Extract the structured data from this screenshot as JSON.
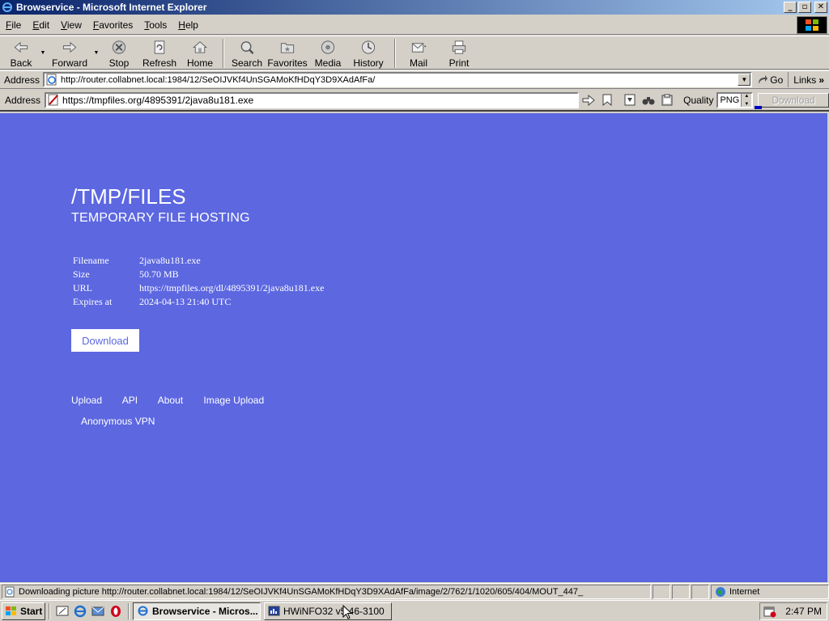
{
  "window": {
    "title": "Browservice - Microsoft Internet Explorer",
    "buttons": {
      "minimize": "_",
      "restore": "▫",
      "close": "✕"
    }
  },
  "menu": [
    {
      "underline": "F",
      "rest": "ile"
    },
    {
      "underline": "E",
      "rest": "dit"
    },
    {
      "underline": "V",
      "rest": "iew"
    },
    {
      "underline": "F",
      "rest": "avorites"
    },
    {
      "underline": "T",
      "rest": "ools"
    },
    {
      "underline": "H",
      "rest": "elp"
    }
  ],
  "toolbar": {
    "back": "Back",
    "forward": "Forward",
    "stop": "Stop",
    "refresh": "Refresh",
    "home": "Home",
    "search": "Search",
    "favorites": "Favorites",
    "media": "Media",
    "history": "History",
    "mail": "Mail",
    "print": "Print"
  },
  "ie_address": {
    "label": "Address",
    "url": "http://router.collabnet.local:1984/12/SeOIJVKf4UnSGAMoKfHDqY3D9XAdAfFa/",
    "go": "Go",
    "links": "Links",
    "more": "»"
  },
  "browservice_bar": {
    "label": "Address",
    "url": "https://tmpfiles.org/4895391/2java8u181.exe",
    "quality_label": "Quality",
    "quality_value": "PNG",
    "download_button": "Download",
    "download_progress": 0.1
  },
  "page": {
    "title": "/TMP/FILES",
    "subtitle": "TEMPORARY FILE HOSTING",
    "info": [
      {
        "key": "Filename",
        "value": "2java8u181.exe"
      },
      {
        "key": "Size",
        "value": "50.70 MB"
      },
      {
        "key": "URL",
        "value": "https://tmpfiles.org/dl/4895391/2java8u181.exe"
      },
      {
        "key": "Expires at",
        "value": "2024-04-13 21:40 UTC"
      }
    ],
    "download_button": "Download",
    "footer_links": [
      "Upload",
      "API",
      "About",
      "Image Upload"
    ],
    "footer_links_2": [
      "Anonymous VPN"
    ],
    "colors": {
      "background": "#5c67e0",
      "text": "#ffffff"
    }
  },
  "status": {
    "text": "Downloading picture http://router.collabnet.local:1984/12/SeOIJVKf4UnSGAMoKfHDqY3D9XAdAfFa/image/2/762/1/1020/605/404/MOUT_447_",
    "zone": "Internet"
  },
  "taskbar": {
    "start": "Start",
    "tasks": [
      {
        "label": "Browservice - Micros...",
        "active": true
      },
      {
        "label": "HWiNFO32 v5.46-3100",
        "active": false
      }
    ],
    "clock": "2:47 PM"
  }
}
